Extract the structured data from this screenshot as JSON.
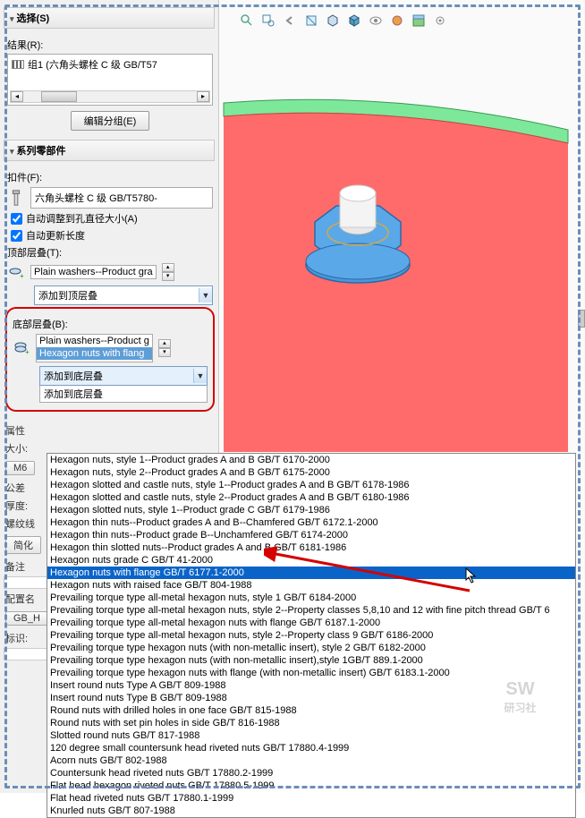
{
  "sections": {
    "select": {
      "title": "选择(S)"
    },
    "result": {
      "title": "结果(R):",
      "item": "组1 (六角头螺栓 C 级 GB/T57",
      "edit_btn": "编辑分组(E)"
    },
    "series": {
      "title": "系列零部件",
      "fastener_label": "扣件(F):",
      "fastener_value": "六角头螺栓 C 级 GB/T5780-",
      "auto_diameter": "自动调整到孔直径大小(A)",
      "auto_length": "自动更新长度",
      "top_label": "顶部层叠(T):",
      "top_value": "Plain washers--Product gra",
      "top_combo": "添加到顶层叠",
      "bottom_label": "底部层叠(B):",
      "bottom_item1": "Plain washers--Product g",
      "bottom_item2": "Hexagon nuts with flang",
      "bottom_combo": "添加到底层叠",
      "bottom_subopt": "添加到底层叠"
    },
    "props": {
      "prop": "属性",
      "size": "大小:",
      "m6": "M6",
      "tol": "公差",
      "thick": "厚度:",
      "thread": "螺纹线",
      "simplify": "简化",
      "remark": "备注",
      "config": "配置名",
      "gbh": "GB_H",
      "mark": "标识:"
    }
  },
  "dropdown_items": [
    "Hexagon nuts, style 1--Product grades A and B GB/T 6170-2000",
    "Hexagon nuts, style 2--Product grades A and B GB/T 6175-2000",
    "Hexagon slotted and castle nuts, style 1--Product grades A and B GB/T 6178-1986",
    "Hexagon slotted and castle nuts, style 2--Product grades A and B GB/T 6180-1986",
    "Hexagon slotted nuts, style 1--Product grade C GB/T 6179-1986",
    "Hexagon thin nuts--Product grades A and B--Chamfered GB/T 6172.1-2000",
    "Hexagon thin nuts--Product grade B--Unchamfered GB/T 6174-2000",
    "Hexagon thin slotted nuts--Product grades A and B GB/T 6181-1986",
    "Hexagon nuts grade C GB/T 41-2000",
    "Hexagon nuts with flange GB/T 6177.1-2000",
    "Hexagon nuts with raised face GB/T 804-1988",
    "Prevailing torque type all-metal hexagon nuts, style 1 GB/T 6184-2000",
    "Prevailing torque type all-metal hexagon nuts, style 2--Property classes 5,8,10 and 12 with fine pitch thread GB/T 6",
    "Prevailing torque type all-metal hexagon nuts with flange GB/T 6187.1-2000",
    "Prevailing torque type all-metal hexagon nuts, style 2--Property class 9 GB/T 6186-2000",
    "Prevailing torque type hexagon nuts (with non-metallic insert), style 2 GB/T 6182-2000",
    "Prevailing torque type hexagon nuts (with non-metallic insert),style 1GB/T 889.1-2000",
    "Prevailing torque type hexagon nuts with flange (with non-metallic insert) GB/T 6183.1-2000",
    "Insert round nuts Type A GB/T 809-1988",
    "Insert round nuts Type B GB/T 809-1988",
    "Round nuts with drilled holes in one face GB/T 815-1988",
    "Round nuts with set pin holes in side GB/T 816-1988",
    "Slotted round nuts GB/T 817-1988",
    "120 degree small countersunk head riveted nuts GB/T 17880.4-1999",
    "Acorn nuts GB/T 802-1988",
    "Countersunk head riveted nuts GB/T 17880.2-1999",
    "Flat head hexagon riveted nuts GB/T 17880.5-1999",
    "Flat head riveted nuts GB/T 17880.1-1999",
    "Knurled nuts GB/T 807-1988"
  ],
  "dropdown_highlight_index": 9,
  "watermark": {
    "main": "SW",
    "sub": "研习社"
  }
}
